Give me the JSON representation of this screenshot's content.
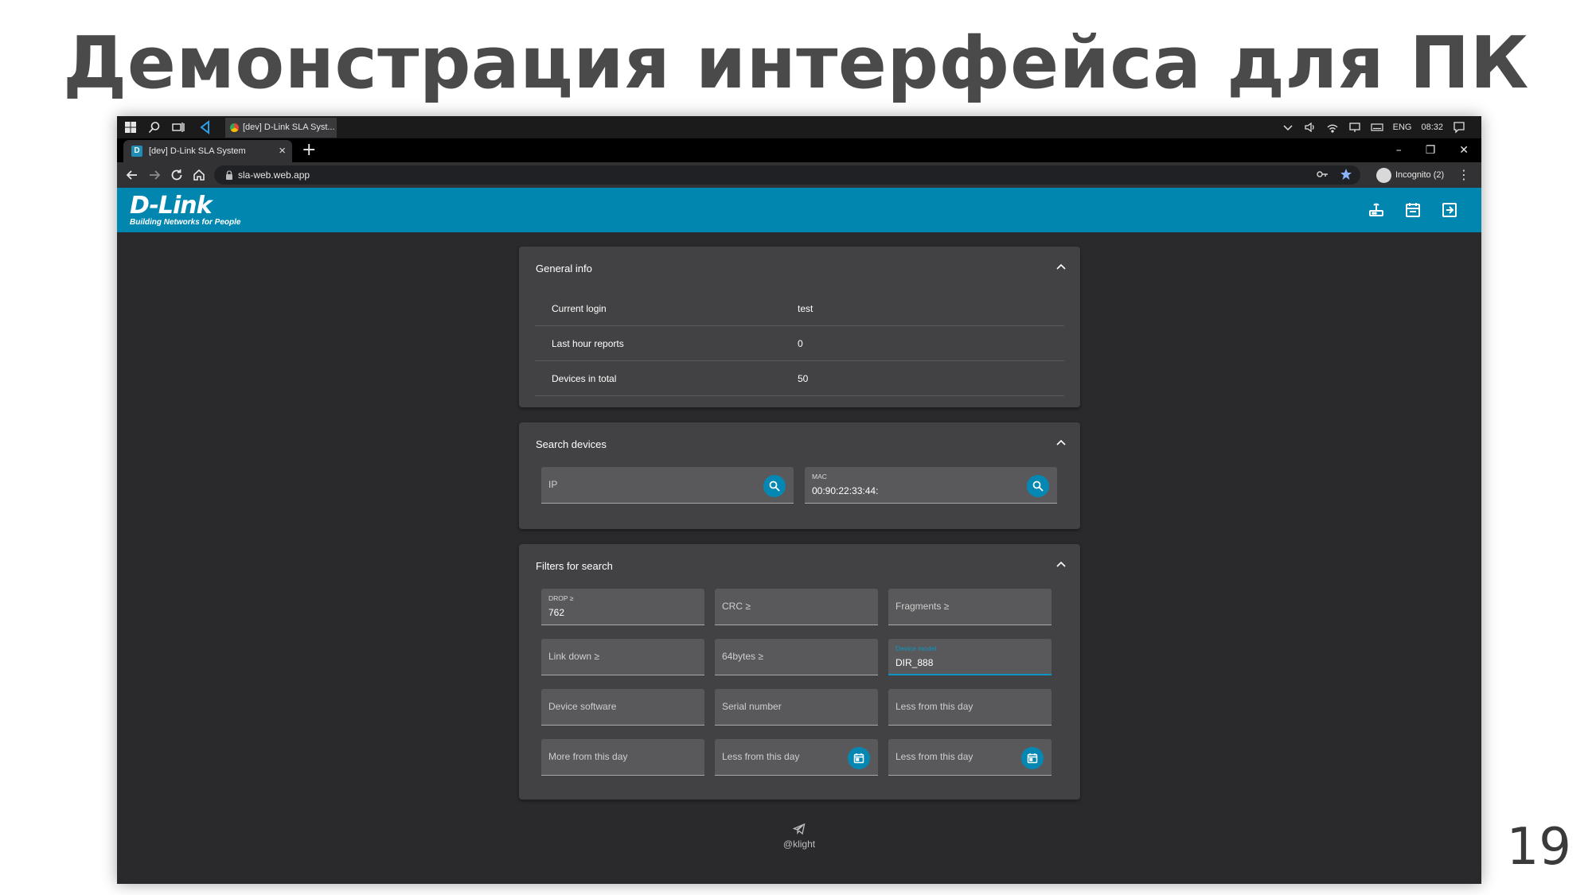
{
  "slide": {
    "title": "Демонстрация интерфейса для ПК",
    "page_number": "19"
  },
  "taskbar": {
    "app_tab": "[dev] D-Link SLA Syst...",
    "language": "ENG",
    "time": "08:32"
  },
  "browser": {
    "tab_title": "[dev] D-Link SLA System",
    "tab_favicon": "D",
    "new_tab": "+",
    "url": "sla-web.web.app",
    "incognito": "Incognito (2)",
    "menu": "⋮",
    "close_tab": "×",
    "win_minimize": "–",
    "win_restore": "❐",
    "win_close": "✕"
  },
  "header": {
    "logo": "D-Link",
    "logo_tagline": "Building Networks for People",
    "accent": "#0186b0"
  },
  "general_info": {
    "title": "General info",
    "rows": [
      {
        "label": "Current login",
        "value": "test"
      },
      {
        "label": "Last hour reports",
        "value": "0"
      },
      {
        "label": "Devices in total",
        "value": "50"
      }
    ]
  },
  "search_devices": {
    "title": "Search devices",
    "ip": {
      "placeholder": "IP"
    },
    "mac": {
      "label": "MAC",
      "value": "00:90:22:33:44:"
    }
  },
  "filters": {
    "title": "Filters for search",
    "drop": {
      "label": "DROP ≥",
      "value": "762"
    },
    "crc": {
      "placeholder": "CRC ≥"
    },
    "fragments": {
      "placeholder": "Fragments ≥"
    },
    "link_down": {
      "placeholder": "Link down ≥"
    },
    "bytes64": {
      "placeholder": "64bytes ≥"
    },
    "device_model": {
      "label": "Device model",
      "value": "DIR_888"
    },
    "device_software": {
      "placeholder": "Device software"
    },
    "serial_number": {
      "placeholder": "Serial number"
    },
    "less_from_day_1": {
      "placeholder": "Less from this day"
    },
    "more_from_day": {
      "placeholder": "More from this day"
    },
    "less_from_day_2": {
      "placeholder": "Less from this day"
    },
    "less_from_day_3": {
      "placeholder": "Less from this day"
    }
  },
  "footer": {
    "text": "@klight"
  }
}
